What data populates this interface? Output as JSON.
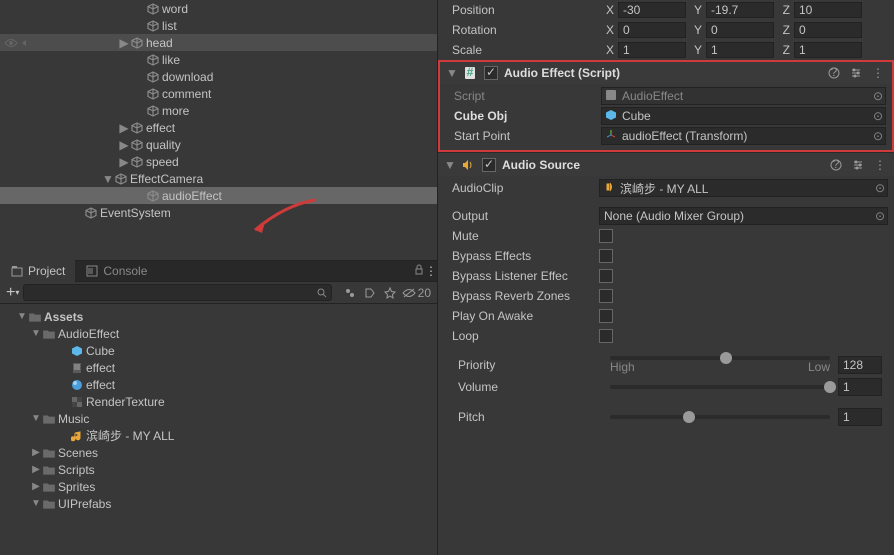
{
  "hierarchy": {
    "items": [
      {
        "indent": 134,
        "expand": "",
        "icon": "cube",
        "label": "word",
        "link": true
      },
      {
        "indent": 134,
        "expand": "",
        "icon": "cube",
        "label": "list",
        "link": true
      },
      {
        "indent": 118,
        "expand": "▶",
        "icon": "cube",
        "label": "head",
        "link": true,
        "selected": true,
        "vis": true
      },
      {
        "indent": 134,
        "expand": "",
        "icon": "cube",
        "label": "like",
        "link": true
      },
      {
        "indent": 134,
        "expand": "",
        "icon": "cube",
        "label": "download",
        "link": true
      },
      {
        "indent": 134,
        "expand": "",
        "icon": "cube",
        "label": "comment",
        "link": true
      },
      {
        "indent": 134,
        "expand": "",
        "icon": "cube",
        "label": "more",
        "link": true
      },
      {
        "indent": 118,
        "expand": "▶",
        "icon": "cube",
        "label": "effect",
        "link": true
      },
      {
        "indent": 118,
        "expand": "▶",
        "icon": "cube",
        "label": "quality",
        "link": true
      },
      {
        "indent": 118,
        "expand": "▶",
        "icon": "cube",
        "label": "speed",
        "link": true
      },
      {
        "indent": 102,
        "expand": "▼",
        "icon": "cube",
        "label": "EffectCamera",
        "link": true
      },
      {
        "indent": 134,
        "expand": "",
        "icon": "cube",
        "label": "audioEffect",
        "link": false,
        "highlight": true
      },
      {
        "indent": 72,
        "expand": "",
        "icon": "cube",
        "label": "EventSystem",
        "link": false
      }
    ]
  },
  "tabs": {
    "project": "Project",
    "console": "Console"
  },
  "toolbar": {
    "search_placeholder": "",
    "visibility_count": "20"
  },
  "project": {
    "items": [
      {
        "indent": 16,
        "expand": "▼",
        "icon": "folder",
        "label": "Assets",
        "bold": true
      },
      {
        "indent": 30,
        "expand": "▼",
        "icon": "folder",
        "label": "AudioEffect"
      },
      {
        "indent": 58,
        "expand": "",
        "icon": "prefab",
        "label": "Cube"
      },
      {
        "indent": 58,
        "expand": "",
        "icon": "script",
        "label": "effect"
      },
      {
        "indent": 58,
        "expand": "",
        "icon": "material",
        "label": "effect"
      },
      {
        "indent": 58,
        "expand": "",
        "icon": "rendertex",
        "label": "RenderTexture"
      },
      {
        "indent": 30,
        "expand": "▼",
        "icon": "folder",
        "label": "Music"
      },
      {
        "indent": 58,
        "expand": "",
        "icon": "audio",
        "label": "滨崎步 - MY ALL"
      },
      {
        "indent": 30,
        "expand": "▶",
        "icon": "folder",
        "label": "Scenes"
      },
      {
        "indent": 30,
        "expand": "▶",
        "icon": "folder",
        "label": "Scripts"
      },
      {
        "indent": 30,
        "expand": "▶",
        "icon": "folder",
        "label": "Sprites"
      },
      {
        "indent": 30,
        "expand": "▼",
        "icon": "folder",
        "label": "UIPrefabs"
      }
    ]
  },
  "inspector": {
    "transform": {
      "position": {
        "label": "Position",
        "x": "-30",
        "y": "-19.7",
        "z": "10"
      },
      "rotation": {
        "label": "Rotation",
        "x": "0",
        "y": "0",
        "z": "0"
      },
      "scale": {
        "label": "Scale",
        "x": "1",
        "y": "1",
        "z": "1"
      }
    },
    "audioEffect": {
      "title": "Audio Effect (Script)",
      "script": {
        "label": "Script",
        "value": "AudioEffect"
      },
      "cubeObj": {
        "label": "Cube Obj",
        "value": "Cube"
      },
      "startPoint": {
        "label": "Start Point",
        "value": "audioEffect (Transform)"
      }
    },
    "audioSource": {
      "title": "Audio Source",
      "audioClip": {
        "label": "AudioClip",
        "value": "滨崎步 - MY ALL"
      },
      "output": {
        "label": "Output",
        "value": "None (Audio Mixer Group)"
      },
      "mute": "Mute",
      "bypassEffects": "Bypass Effects",
      "bypassListener": "Bypass Listener Effec",
      "bypassReverb": "Bypass Reverb Zones",
      "playOnAwake": "Play On Awake",
      "loop": "Loop",
      "priority": {
        "label": "Priority",
        "value": "128",
        "low": "High",
        "high": "Low"
      },
      "volume": {
        "label": "Volume",
        "value": "1"
      },
      "pitch": {
        "label": "Pitch",
        "value": "1"
      }
    }
  }
}
